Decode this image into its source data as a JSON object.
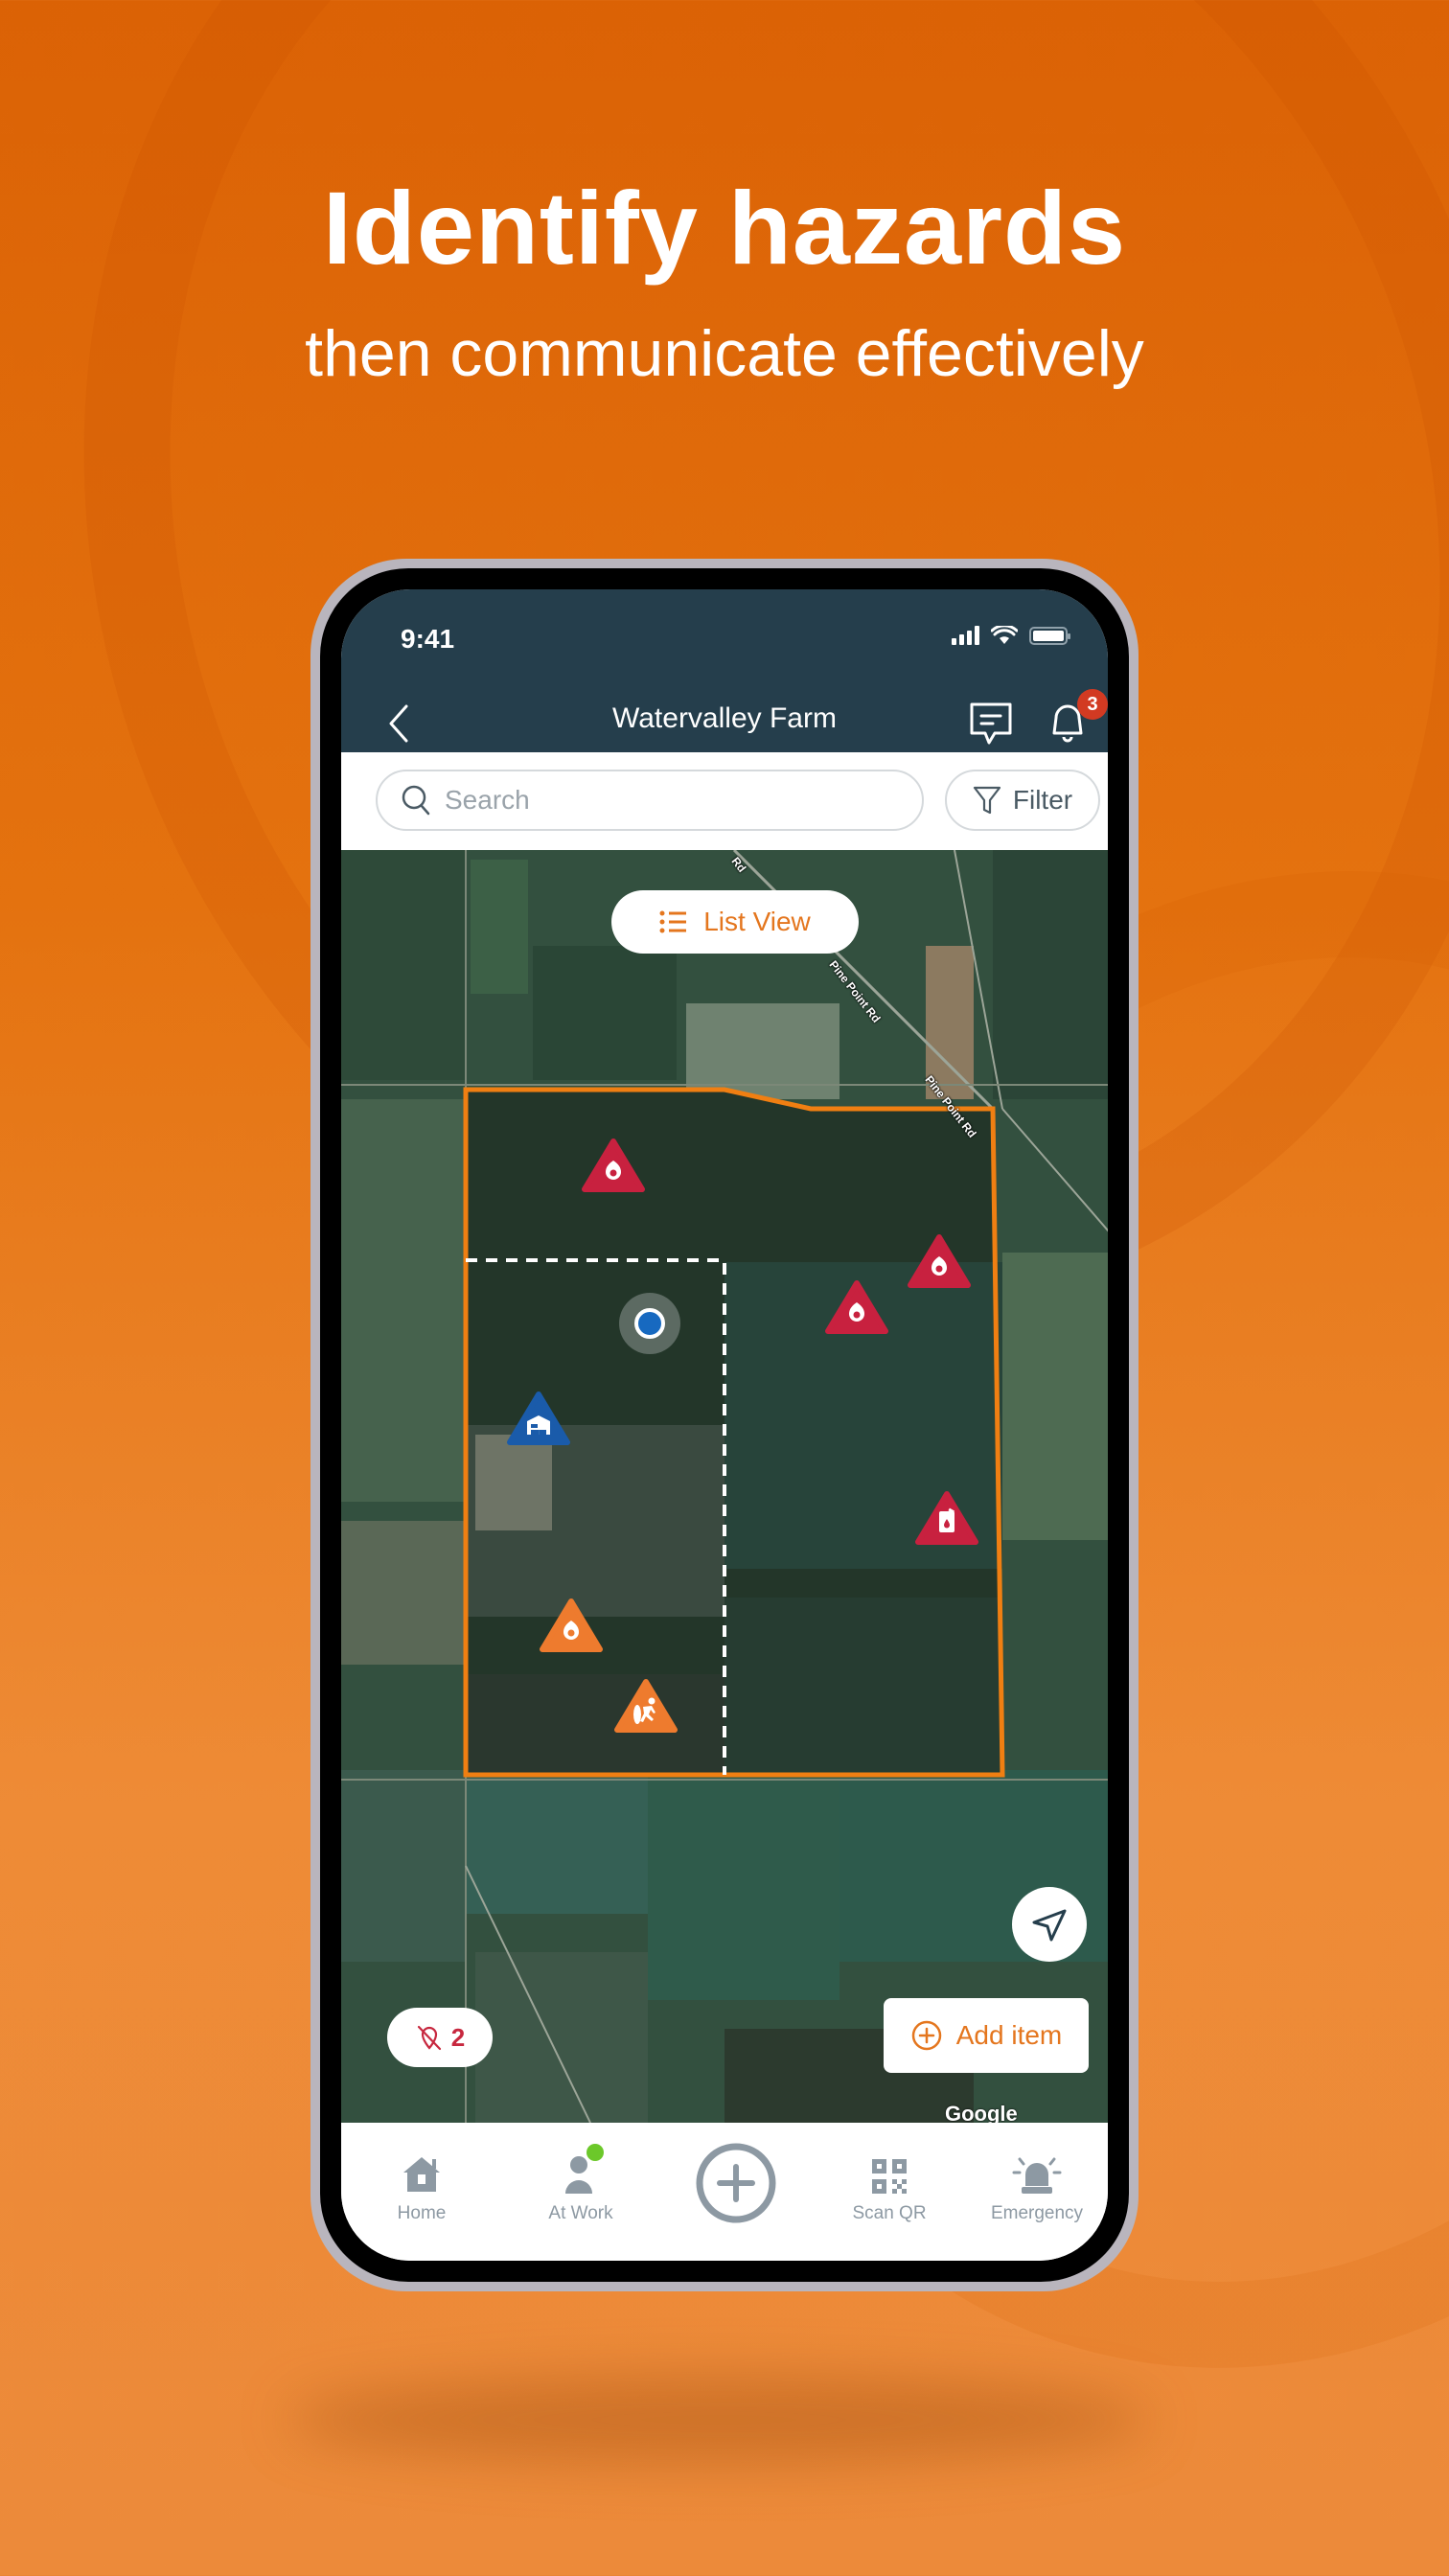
{
  "headline": "Identify hazards",
  "subline": "then communicate effectively",
  "status_bar": {
    "time": "9:41"
  },
  "header": {
    "title": "Watervalley Farm",
    "notification_count": "3",
    "icons": [
      "back-chevron-icon",
      "chat-icon",
      "bell-icon"
    ]
  },
  "search": {
    "placeholder": "Search",
    "value": "",
    "filter_label": "Filter"
  },
  "map": {
    "list_view_label": "List View",
    "road_labels": [
      "Rd",
      "Pine Point Rd",
      "Pine Point Rd"
    ],
    "markers": [
      {
        "type": "fire-hazard",
        "severity": "high",
        "color": "#C8213F"
      },
      {
        "type": "fire-hazard",
        "severity": "high",
        "color": "#C8213F"
      },
      {
        "type": "fire-hazard",
        "severity": "high",
        "color": "#C8213F"
      },
      {
        "type": "fuel-hazard",
        "severity": "high",
        "color": "#C8213F"
      },
      {
        "type": "building",
        "severity": "info",
        "color": "#1A5BAA"
      },
      {
        "type": "fire-hazard",
        "severity": "medium",
        "color": "#EE7B2E"
      },
      {
        "type": "slip-fall-hazard",
        "severity": "medium",
        "color": "#EE7B2E"
      }
    ],
    "boundary_color": "#F07F12",
    "hidden_count": "2",
    "add_item_label": "Add item",
    "attribution": "Google"
  },
  "bottom_nav": {
    "items": [
      {
        "label": "Home",
        "icon": "home-icon"
      },
      {
        "label": "At Work",
        "icon": "person-icon",
        "status_color": "#6CC82A"
      },
      {
        "label": "",
        "icon": "add-circle-icon"
      },
      {
        "label": "Scan QR",
        "icon": "qr-code-icon"
      },
      {
        "label": "Emergency",
        "icon": "siren-icon"
      }
    ]
  },
  "colors": {
    "accent": "#E4761E",
    "header_bg": "#253E4C",
    "background": "#E4720F"
  }
}
